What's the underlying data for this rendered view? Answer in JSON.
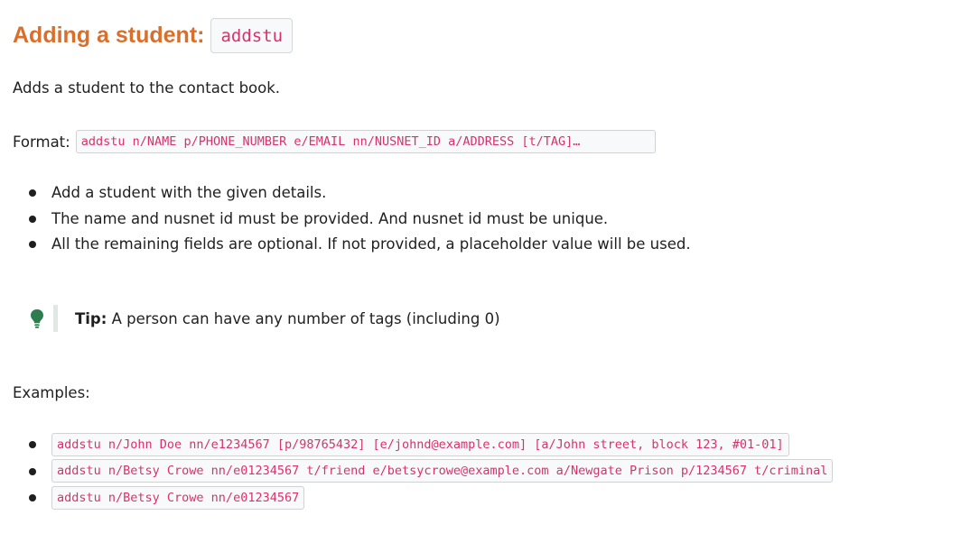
{
  "heading": {
    "title": "Adding a student:",
    "command": "addstu"
  },
  "description": "Adds a student to the contact book.",
  "format": {
    "label": "Format:",
    "code": "addstu n/NAME p/PHONE_NUMBER e/EMAIL nn/NUSNET_ID a/ADDRESS [t/TAG]…"
  },
  "bullets": [
    "Add a student with the given details.",
    "The name and nusnet id must be provided. And nusnet id must be unique.",
    "All the remaining fields are optional. If not provided, a placeholder value will be used."
  ],
  "tip": {
    "label": "Tip:",
    "text": " A person can have any number of tags (including 0)",
    "icon": "lightbulb-icon",
    "icon_color": "#2e7d4f"
  },
  "examples_label": "Examples:",
  "examples": [
    "addstu n/John Doe nn/e1234567 [p/98765432] [e/johnd@example.com] [a/John street, block 123, #01-01]",
    "addstu n/Betsy Crowe nn/e01234567 t/friend e/betsycrowe@example.com a/Newgate Prison p/1234567 t/criminal",
    "addstu n/Betsy Crowe nn/e01234567"
  ],
  "colors": {
    "heading": "#d96f2a",
    "code_text": "#d6336c",
    "code_bg": "#f8f9fa"
  }
}
